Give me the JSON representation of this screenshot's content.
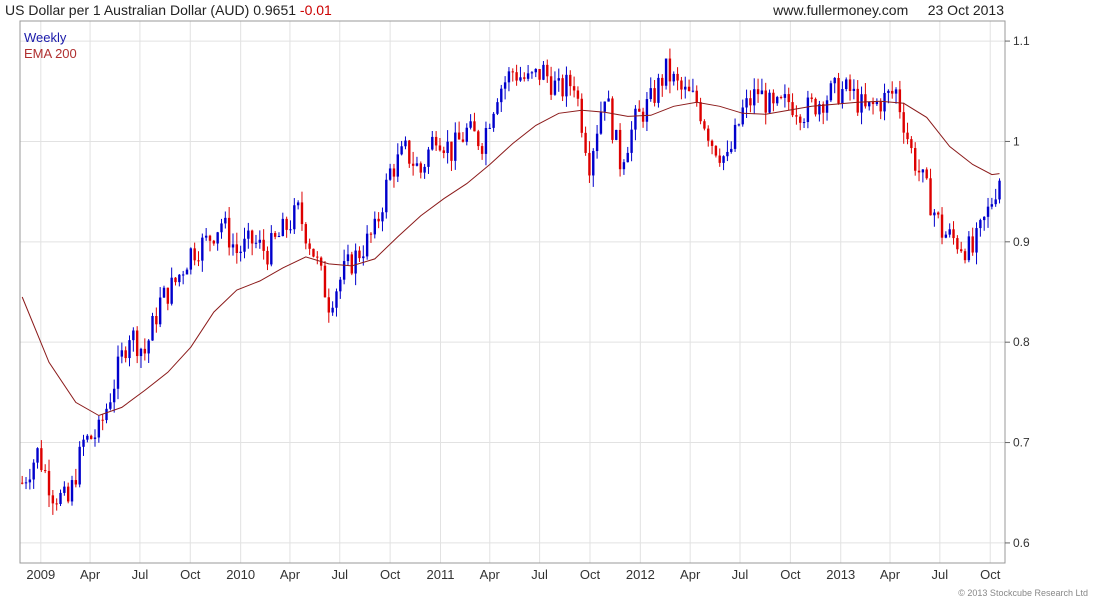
{
  "header": {
    "title": "US Dollar per 1 Australian Dollar (AUD)",
    "price": "0.9651",
    "change": "-0.01",
    "website": "www.fullermoney.com",
    "date": "23 Oct 2013"
  },
  "legend": {
    "interval": "Weekly",
    "indicator": "EMA 200"
  },
  "footer": "© 2013 Stockcube Research Ltd",
  "colors": {
    "up": "#0000cc",
    "down": "#dd0000",
    "ema": "#8b1a1a",
    "grid": "#e2e2e2"
  },
  "chart_data": {
    "type": "line",
    "title": "US Dollar per 1 Australian Dollar (AUD) 0.9651 -0.01",
    "xlabel": "",
    "ylabel": "",
    "ylim": [
      0.6,
      1.1
    ],
    "y_ticks": [
      "0.6",
      "0.7",
      "0.8",
      "0.9",
      "1",
      "1.1"
    ],
    "x_ticks": [
      "2009",
      "Apr",
      "Jul",
      "Oct",
      "2010",
      "Apr",
      "Jul",
      "Oct",
      "2011",
      "Apr",
      "Jul",
      "Oct",
      "2012",
      "Apr",
      "Jul",
      "Oct",
      "2013",
      "Apr",
      "Jul",
      "Oct"
    ],
    "x_tick_dates": [
      "2009-01-01",
      "2009-04-01",
      "2009-07-01",
      "2009-10-01",
      "2010-01-01",
      "2010-04-01",
      "2010-07-01",
      "2010-10-01",
      "2011-01-01",
      "2011-04-01",
      "2011-07-01",
      "2011-10-01",
      "2012-01-01",
      "2012-04-01",
      "2012-07-01",
      "2012-10-01",
      "2013-01-01",
      "2013-04-01",
      "2013-07-01",
      "2013-10-01"
    ],
    "grid": true,
    "series": [
      {
        "name": "Weekly",
        "points": [
          [
            "2008-11-28",
            0.66
          ],
          [
            "2008-12-26",
            0.69
          ],
          [
            "2009-01-23",
            0.65
          ],
          [
            "2009-02-20",
            0.64
          ],
          [
            "2009-03-20",
            0.7
          ],
          [
            "2009-04-17",
            0.71
          ],
          [
            "2009-05-15",
            0.76
          ],
          [
            "2009-06-12",
            0.81
          ],
          [
            "2009-07-10",
            0.79
          ],
          [
            "2009-08-07",
            0.84
          ],
          [
            "2009-09-04",
            0.86
          ],
          [
            "2009-10-02",
            0.89
          ],
          [
            "2009-10-30",
            0.9
          ],
          [
            "2009-11-27",
            0.92
          ],
          [
            "2009-12-25",
            0.89
          ],
          [
            "2010-01-22",
            0.9
          ],
          [
            "2010-02-19",
            0.89
          ],
          [
            "2010-03-19",
            0.91
          ],
          [
            "2010-04-16",
            0.93
          ],
          [
            "2010-05-14",
            0.89
          ],
          [
            "2010-06-11",
            0.84
          ],
          [
            "2010-07-09",
            0.87
          ],
          [
            "2010-08-06",
            0.89
          ],
          [
            "2010-09-03",
            0.91
          ],
          [
            "2010-10-01",
            0.97
          ],
          [
            "2010-10-29",
            0.99
          ],
          [
            "2010-11-26",
            0.97
          ],
          [
            "2010-12-24",
            1.01
          ],
          [
            "2011-01-21",
            0.99
          ],
          [
            "2011-02-18",
            1.01
          ],
          [
            "2011-03-18",
            1.0
          ],
          [
            "2011-04-15",
            1.05
          ],
          [
            "2011-05-13",
            1.07
          ],
          [
            "2011-06-10",
            1.06
          ],
          [
            "2011-07-08",
            1.07
          ],
          [
            "2011-08-05",
            1.05
          ],
          [
            "2011-09-02",
            1.06
          ],
          [
            "2011-09-30",
            0.98
          ],
          [
            "2011-10-28",
            1.05
          ],
          [
            "2011-11-25",
            0.98
          ],
          [
            "2011-12-23",
            1.02
          ],
          [
            "2012-01-20",
            1.04
          ],
          [
            "2012-02-17",
            1.07
          ],
          [
            "2012-03-16",
            1.05
          ],
          [
            "2012-04-13",
            1.04
          ],
          [
            "2012-05-11",
            1.0
          ],
          [
            "2012-06-08",
            0.98
          ],
          [
            "2012-07-06",
            1.03
          ],
          [
            "2012-08-03",
            1.05
          ],
          [
            "2012-08-31",
            1.03
          ],
          [
            "2012-09-28",
            1.04
          ],
          [
            "2012-10-26",
            1.03
          ],
          [
            "2012-11-23",
            1.04
          ],
          [
            "2012-12-21",
            1.05
          ],
          [
            "2013-01-18",
            1.05
          ],
          [
            "2013-02-15",
            1.03
          ],
          [
            "2013-03-15",
            1.04
          ],
          [
            "2013-04-12",
            1.05
          ],
          [
            "2013-05-10",
            0.99
          ],
          [
            "2013-06-07",
            0.95
          ],
          [
            "2013-07-05",
            0.91
          ],
          [
            "2013-08-02",
            0.9
          ],
          [
            "2013-08-30",
            0.89
          ],
          [
            "2013-09-27",
            0.93
          ],
          [
            "2013-10-18",
            0.9651
          ]
        ]
      },
      {
        "name": "EMA 200",
        "points": [
          [
            "2008-11-28",
            0.845
          ],
          [
            "2009-01-16",
            0.78
          ],
          [
            "2009-03-06",
            0.74
          ],
          [
            "2009-04-17",
            0.727
          ],
          [
            "2009-05-29",
            0.735
          ],
          [
            "2009-07-10",
            0.752
          ],
          [
            "2009-08-21",
            0.77
          ],
          [
            "2009-10-02",
            0.795
          ],
          [
            "2009-11-13",
            0.83
          ],
          [
            "2009-12-25",
            0.852
          ],
          [
            "2010-02-05",
            0.861
          ],
          [
            "2010-03-19",
            0.874
          ],
          [
            "2010-04-30",
            0.885
          ],
          [
            "2010-06-11",
            0.878
          ],
          [
            "2010-07-23",
            0.876
          ],
          [
            "2010-09-03",
            0.883
          ],
          [
            "2010-10-15",
            0.905
          ],
          [
            "2010-11-26",
            0.926
          ],
          [
            "2011-01-07",
            0.943
          ],
          [
            "2011-02-18",
            0.958
          ],
          [
            "2011-04-01",
            0.977
          ],
          [
            "2011-05-13",
            0.998
          ],
          [
            "2011-06-24",
            1.016
          ],
          [
            "2011-08-05",
            1.028
          ],
          [
            "2011-09-16",
            1.031
          ],
          [
            "2011-10-28",
            1.029
          ],
          [
            "2011-12-09",
            1.025
          ],
          [
            "2012-01-20",
            1.026
          ],
          [
            "2012-03-02",
            1.035
          ],
          [
            "2012-04-13",
            1.039
          ],
          [
            "2012-05-25",
            1.035
          ],
          [
            "2012-07-06",
            1.028
          ],
          [
            "2012-08-17",
            1.027
          ],
          [
            "2012-09-28",
            1.031
          ],
          [
            "2012-11-09",
            1.035
          ],
          [
            "2012-12-21",
            1.037
          ],
          [
            "2013-02-01",
            1.039
          ],
          [
            "2013-03-15",
            1.04
          ],
          [
            "2013-04-26",
            1.038
          ],
          [
            "2013-06-07",
            1.024
          ],
          [
            "2013-07-19",
            0.995
          ],
          [
            "2013-08-30",
            0.977
          ],
          [
            "2013-10-04",
            0.967
          ],
          [
            "2013-10-18",
            0.968
          ]
        ]
      }
    ]
  }
}
